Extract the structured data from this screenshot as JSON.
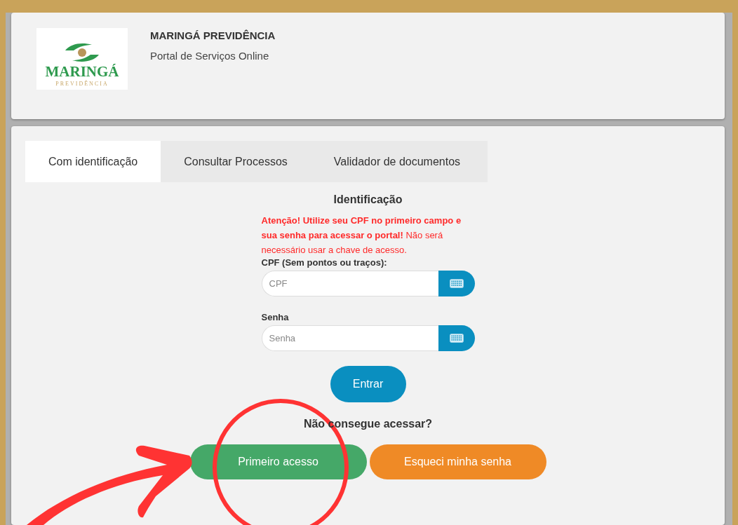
{
  "header": {
    "logo": {
      "name": "MARINGÁ",
      "subname": "PREVIDÊNCIA"
    },
    "title": "MARINGÁ PREVIDÊNCIA",
    "subtitle": "Portal de Serviços Online"
  },
  "tabs": [
    {
      "label": "Com identificação",
      "selected": true
    },
    {
      "label": "Consultar Processos",
      "selected": false
    },
    {
      "label": "Validador de documentos",
      "selected": false
    }
  ],
  "form": {
    "heading": "Identificação",
    "warning": "**Atenção! Utilize seu CPF no primeiro campo e sua senha para acessar o portal!** Não será necessário usar a chave de acesso.",
    "fields": [
      {
        "label": "CPF (Sem pontos ou traços):",
        "placeholder": "CPF"
      },
      {
        "label": "Senha",
        "placeholder": "Senha"
      }
    ],
    "submit": "Entrar",
    "help": "Não consegue acessar?",
    "actions": [
      {
        "label": "Primeiro acesso",
        "color": "#45a868"
      },
      {
        "label": "Esqueci minha senha",
        "color": "#ef8a26"
      }
    ]
  }
}
